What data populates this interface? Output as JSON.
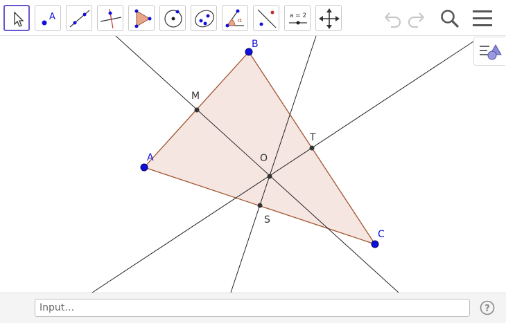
{
  "toolbar": {
    "tools": [
      {
        "name": "move-tool"
      },
      {
        "name": "point-tool",
        "glyph": "A"
      },
      {
        "name": "line-tool"
      },
      {
        "name": "perpendicular-line-tool"
      },
      {
        "name": "polygon-tool"
      },
      {
        "name": "circle-center-point-tool"
      },
      {
        "name": "conic-tool"
      },
      {
        "name": "angle-tool",
        "glyph": "α"
      },
      {
        "name": "reflect-tool"
      },
      {
        "name": "slider-tool",
        "glyph": "a = 2"
      },
      {
        "name": "move-graphics-view-tool"
      }
    ]
  },
  "construction": {
    "points": {
      "A": "A",
      "B": "B",
      "C": "C",
      "M": "M",
      "T": "T",
      "O": "O",
      "S": "S"
    }
  },
  "colors": {
    "free_point": "#1010dd",
    "triangle_fill": "#f5e6e1",
    "triangle_edge": "#a0522d",
    "line": "#222222",
    "active_tool": "#6557d2"
  },
  "inputbar": {
    "placeholder": "Input…",
    "help_glyph": "?"
  }
}
